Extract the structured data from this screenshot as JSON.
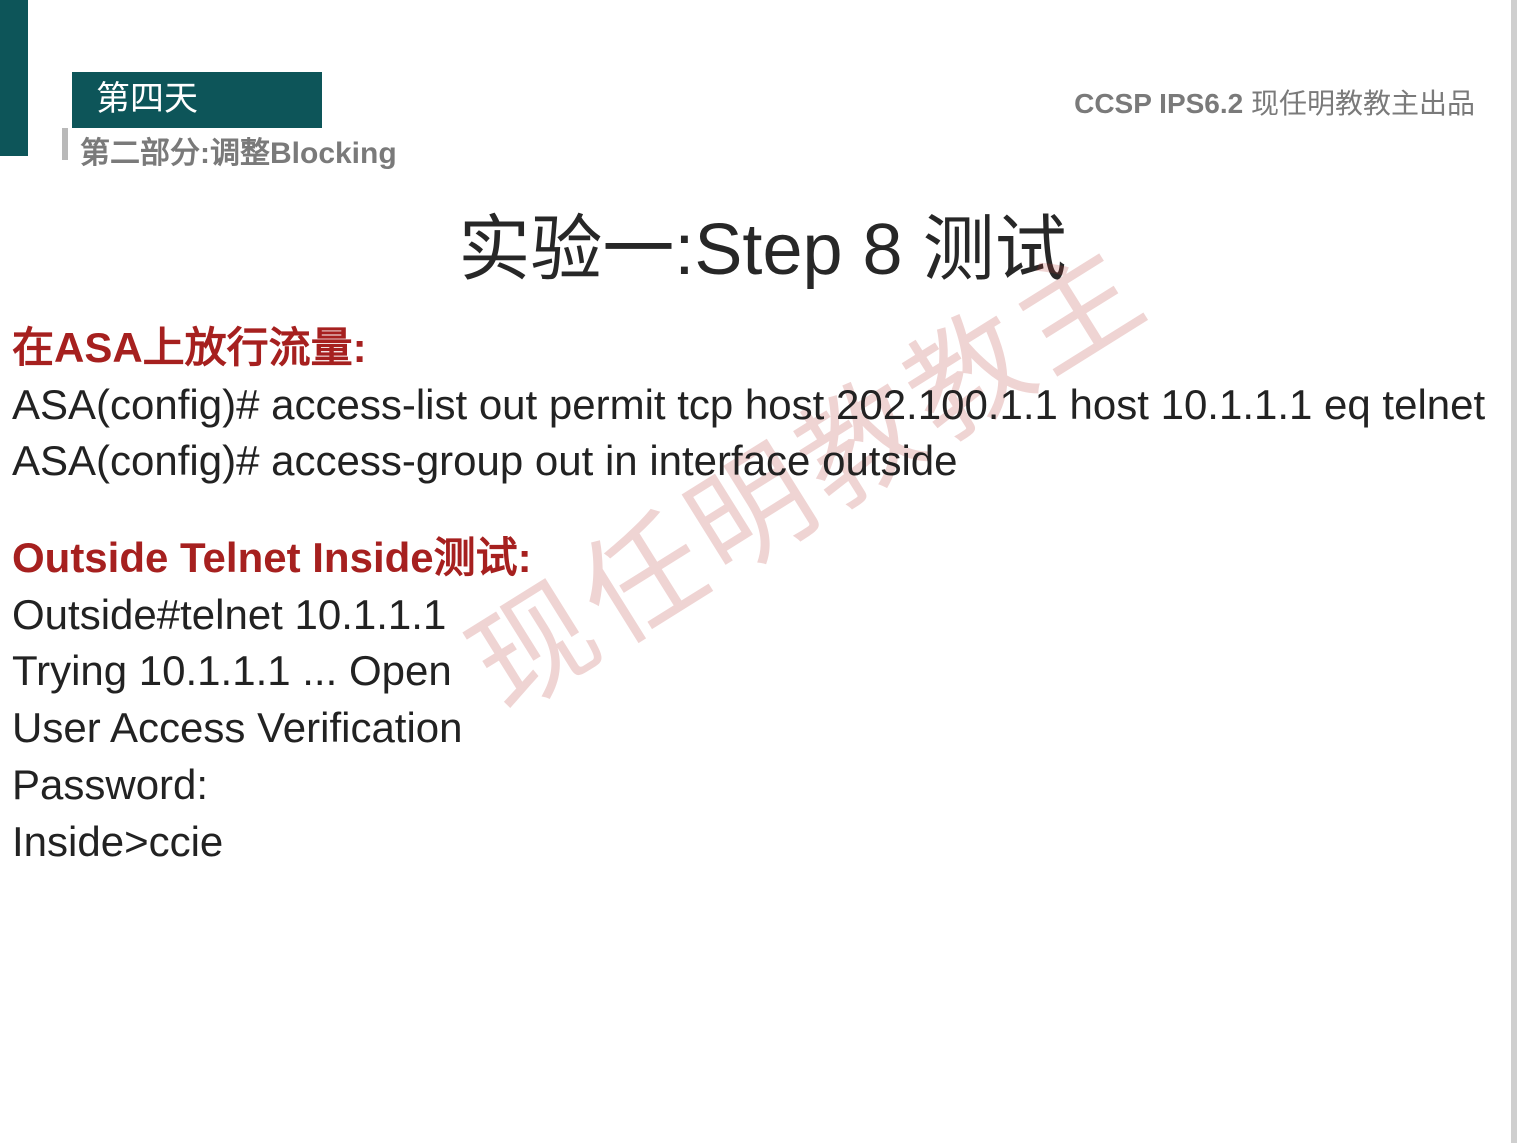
{
  "header": {
    "day": "第四天",
    "section": "第二部分:调整Blocking",
    "course_bold": "CCSP IPS6.2",
    "course_rest": " 现任明教教主出品"
  },
  "title": "实验一:Step 8 测试",
  "watermark": "现任明教教主",
  "block1": {
    "heading": "在ASA上放行流量:",
    "line1": "ASA(config)# access-list out  permit tcp host 202.100.1.1 host 10.1.1.1 eq telnet",
    "line2": "ASA(config)# access-group out in interface outside"
  },
  "block2": {
    "heading": "Outside Telnet Inside测试:",
    "line1": "Outside#telnet 10.1.1.1",
    "line2": "Trying 10.1.1.1 ... Open",
    "line3": "User Access Verification",
    "line4": "Password:",
    "line5": "Inside>ccie"
  }
}
